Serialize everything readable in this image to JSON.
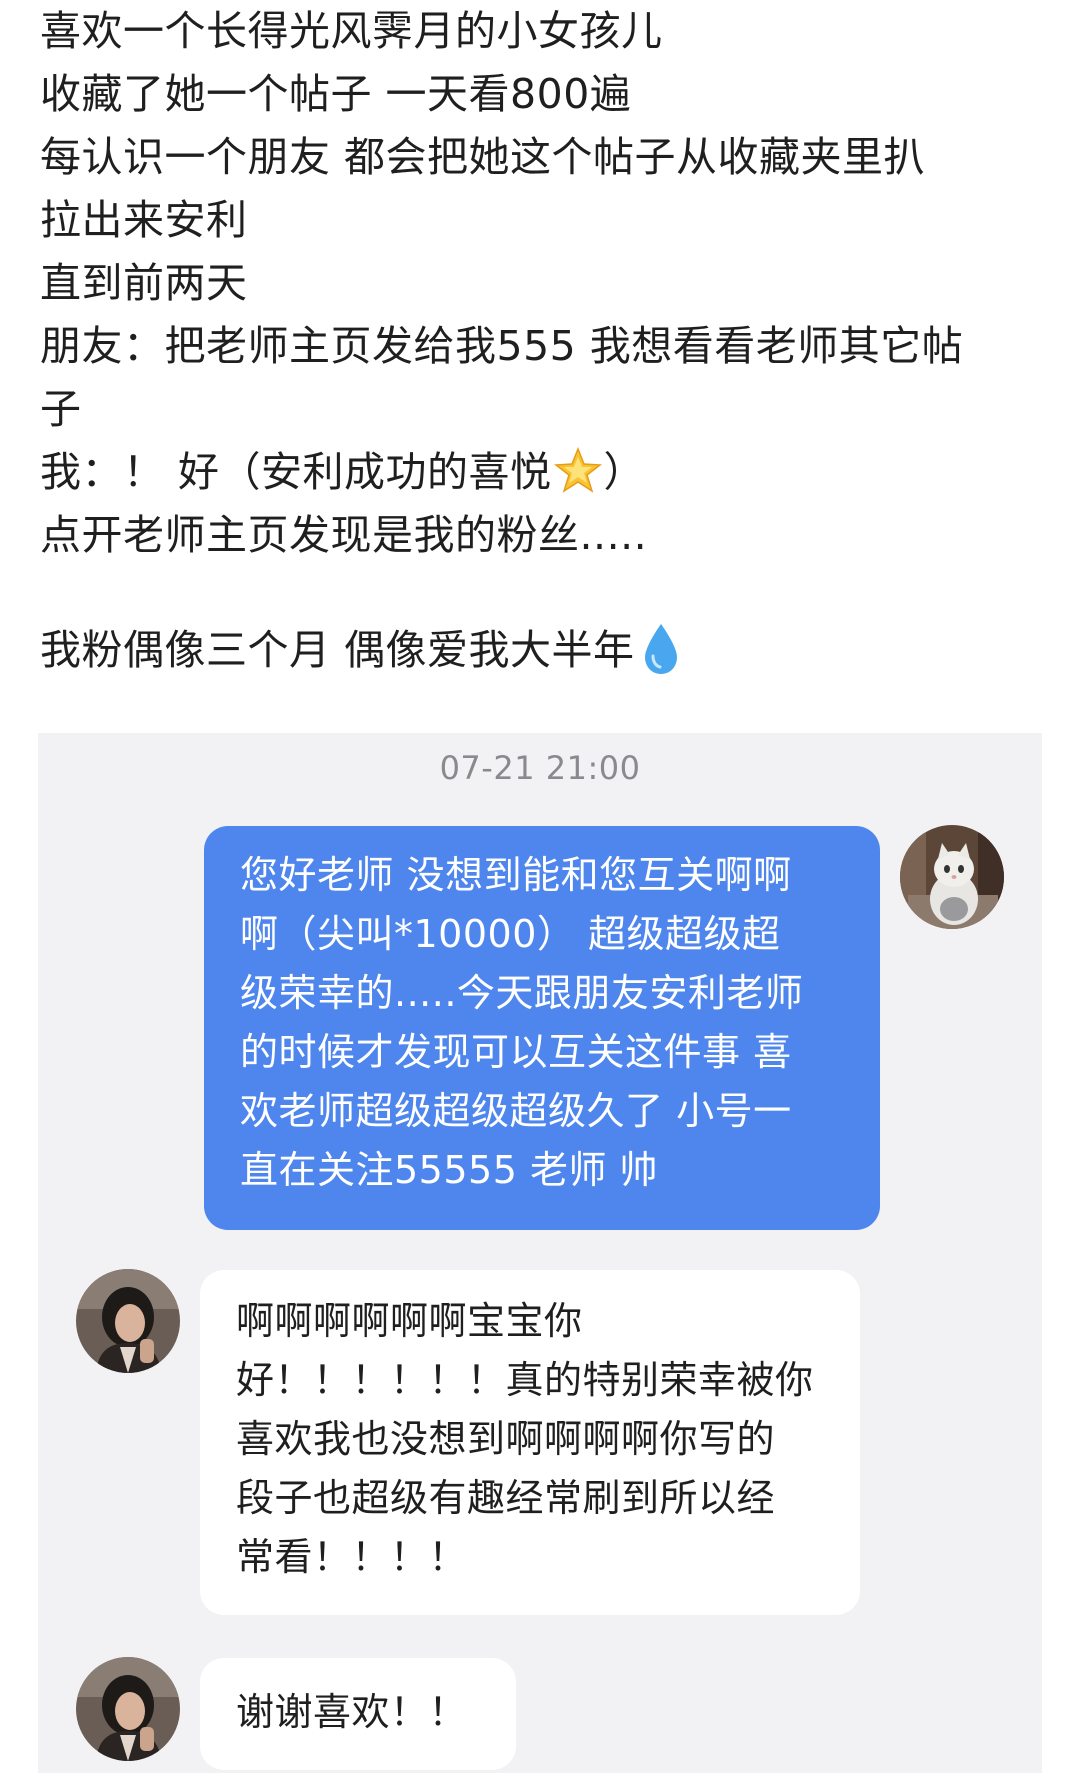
{
  "post": {
    "lines": [
      "喜欢一个长得光风霁月的小女孩儿",
      "收藏了她一个帖子 一天看800遍",
      "每认识一个朋友 都会把她这个帖子从收藏夹里扒",
      "拉出来安利",
      "直到前两天",
      "朋友：把老师主页发给我555 我想看看老师其它帖",
      "子",
      "我：！ 好（安利成功的喜悦",
      "）",
      "点开老师主页发现是我的粉丝.....",
      "我粉偶像三个月 偶像爱我大半年"
    ],
    "emoji": {
      "star": "glowing-star",
      "drop": "droplet"
    }
  },
  "chat": {
    "timestamp": "07-21 21:00",
    "messages": [
      {
        "side": "right",
        "lines": [
          "您好老师 没想到能和您互关啊啊",
          "啊（尖叫*10000） 超级超级超",
          "级荣幸的.....今天跟朋友安利老师",
          "的时候才发现可以互关这件事 喜",
          "欢老师超级超级超级久了 小号一",
          "直在关注55555 老师 帅"
        ]
      },
      {
        "side": "left",
        "lines": [
          "啊啊啊啊啊啊宝宝你",
          "好！！！！！！真的特别荣幸被你",
          "喜欢我也没想到啊啊啊啊你写的",
          "段子也超级有趣经常刷到所以经",
          "常看！！！！"
        ]
      },
      {
        "side": "left",
        "lines": [
          "谢谢喜欢！！"
        ]
      }
    ]
  },
  "colors": {
    "outgoing_bubble": "#4e86ee",
    "chat_background": "#f2f2f4",
    "incoming_bubble": "#ffffff"
  }
}
